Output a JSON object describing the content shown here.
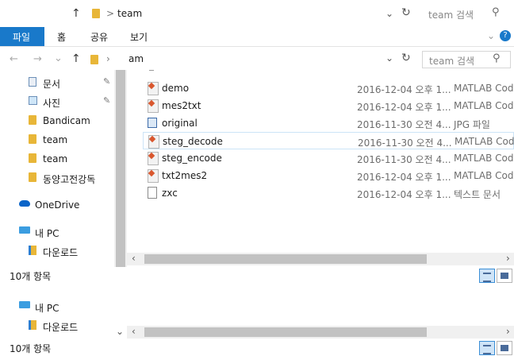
{
  "titlebar": {
    "path_sep": ">",
    "folder": "team",
    "search_placeholder": "team 검색"
  },
  "ribbon": {
    "tabs": [
      "파일",
      "홈",
      "공유",
      "보기"
    ]
  },
  "addressbar": {
    "path_text": "am",
    "search_placeholder": "team 검색"
  },
  "sidebar": {
    "items": [
      {
        "label": "문서",
        "pinned": true,
        "icon": "documents-icon"
      },
      {
        "label": "사진",
        "pinned": true,
        "icon": "pictures-icon"
      },
      {
        "label": "Bandicam",
        "icon": "folder-icon"
      },
      {
        "label": "team",
        "icon": "folder-icon"
      },
      {
        "label": "team",
        "icon": "folder-icon"
      },
      {
        "label": "동양고전강독",
        "icon": "folder-icon"
      },
      {
        "label": "OneDrive",
        "icon": "onedrive-icon"
      },
      {
        "label": "내 PC",
        "icon": "pc-icon"
      },
      {
        "label": "다운로드",
        "icon": "download-folder-icon"
      }
    ],
    "lower": [
      {
        "label": "내 PC",
        "icon": "pc-icon"
      },
      {
        "label": "다운로드",
        "icon": "download-folder-icon"
      }
    ]
  },
  "files": [
    {
      "name": "demo",
      "date": "2016-12-04 오후 1...",
      "type": "MATLAB Code",
      "icon": "matlab-icon"
    },
    {
      "name": "mes2txt",
      "date": "2016-12-04 오후 1...",
      "type": "MATLAB Code",
      "icon": "matlab-icon"
    },
    {
      "name": "original",
      "date": "2016-11-30 오전 4...",
      "type": "JPG 파일",
      "icon": "image-icon"
    },
    {
      "name": "steg_decode",
      "date": "2016-11-30 오전 4...",
      "type": "MATLAB Code",
      "icon": "matlab-icon"
    },
    {
      "name": "steg_encode",
      "date": "2016-11-30 오전 4...",
      "type": "MATLAB Code",
      "icon": "matlab-icon"
    },
    {
      "name": "txt2mes2",
      "date": "2016-12-04 오후 1...",
      "type": "MATLAB Code",
      "icon": "matlab-icon"
    },
    {
      "name": "zxc",
      "date": "2016-12-04 오후 1...",
      "type": "텍스트 문서",
      "icon": "text-file-icon"
    }
  ],
  "status": {
    "count_text": "10개 항목",
    "count_text_2": "10개 항목"
  }
}
